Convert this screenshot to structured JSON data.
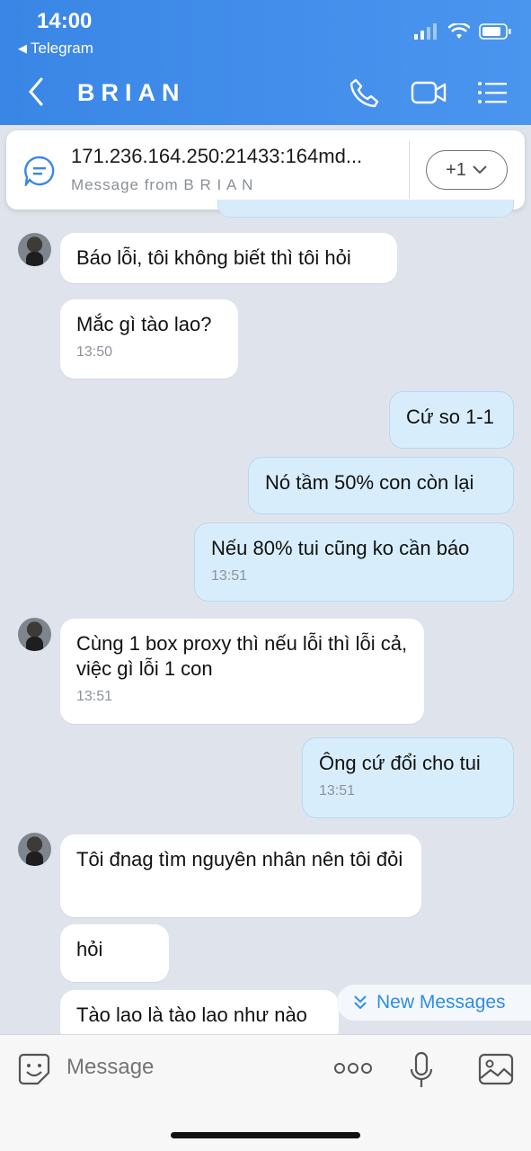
{
  "status": {
    "time": "14:00",
    "back_app": "Telegram"
  },
  "header": {
    "title": "BRIAN"
  },
  "pinned": {
    "text": "171.236.164.250:21433:164md...",
    "sub": "Message from B R I A N",
    "badge": "+1"
  },
  "messages": [
    {
      "text": "Báo lỗi, tôi không biết thì tôi hỏi"
    },
    {
      "text": "Mắc gì tào lao?",
      "time": "13:50"
    },
    {
      "text": "Cứ so 1-1"
    },
    {
      "text": "Nó tầm 50% con còn lại"
    },
    {
      "text": "Nếu 80% tui cũng ko cần báo",
      "time": "13:51"
    },
    {
      "text": "Cùng 1 box proxy thì nếu lỗi thì lỗi cả, việc gì lỗi 1 con",
      "time": "13:51"
    },
    {
      "text": "Ông cứ đổi cho tui",
      "time": "13:51"
    },
    {
      "text": "Tôi đnag tìm nguyên nhân nên tôi đỏi"
    },
    {
      "text": "hỏi"
    },
    {
      "text": "Tào lao là tào lao như nào"
    }
  ],
  "new_messages": "New Messages",
  "input": {
    "placeholder": "Message"
  },
  "colors": {
    "header": "#3a86e6",
    "outgoing_bubble": "#d8edfc",
    "incoming_bubble": "#ffffff",
    "chat_bg": "#dfe4ec",
    "accent": "#2f8de4"
  }
}
